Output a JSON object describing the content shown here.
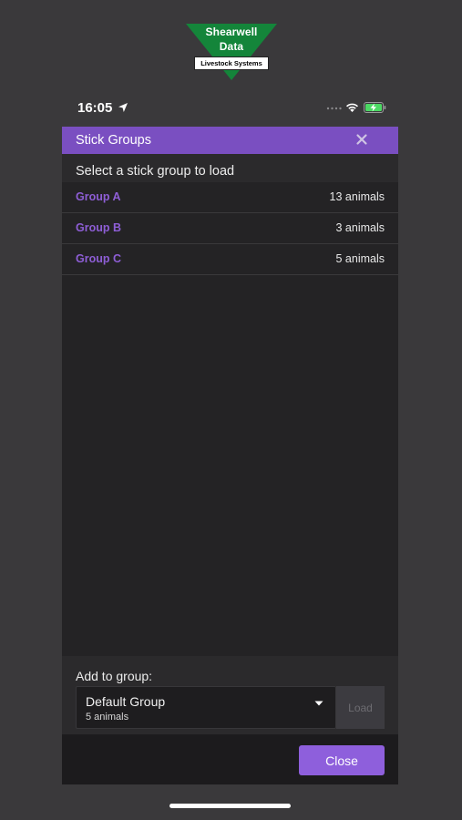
{
  "logo": {
    "line1": "Shearwell",
    "line2": "Data",
    "sub": "Livestock Systems"
  },
  "status_bar": {
    "time": "16:05"
  },
  "modal": {
    "title": "Stick Groups",
    "subtitle": "Select a stick group to load",
    "groups": [
      {
        "name": "Group A",
        "count": "13 animals"
      },
      {
        "name": "Group B",
        "count": "3 animals"
      },
      {
        "name": "Group C",
        "count": "5 animals"
      }
    ],
    "add_to_group_label": "Add to group:",
    "select": {
      "value": "Default Group",
      "sub": "5 animals"
    },
    "load_label": "Load",
    "close_label": "Close"
  },
  "colors": {
    "accent": "#7a4fc1",
    "group_name": "#8e5ed6",
    "close_button": "#8e5fdc",
    "logo_green": "#14853a"
  },
  "icons": {
    "close": "close-icon",
    "location": "location-arrow-icon",
    "signal": "signal-icon",
    "wifi": "wifi-icon",
    "battery": "battery-charging-icon",
    "caret": "caret-down-icon"
  }
}
